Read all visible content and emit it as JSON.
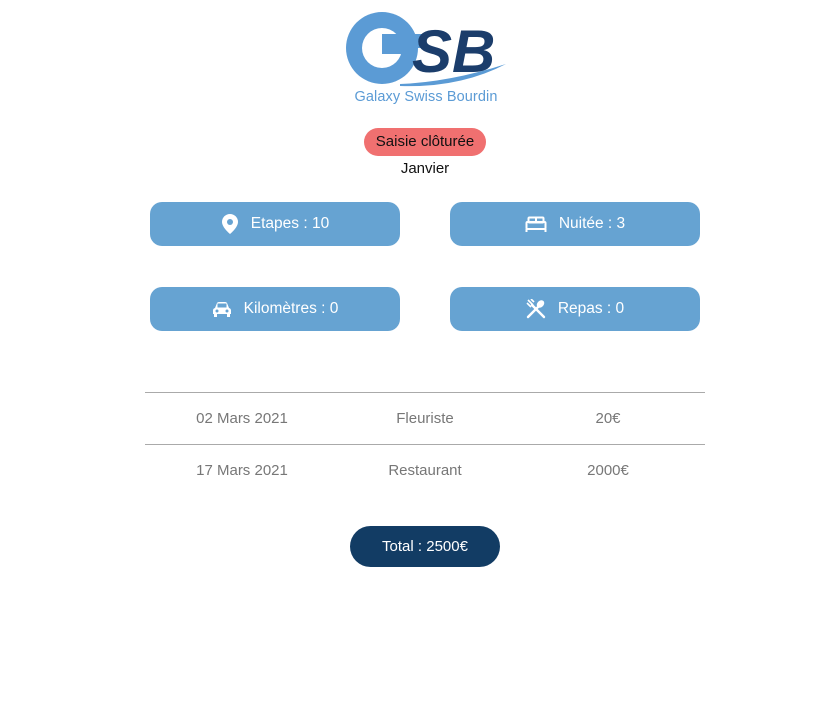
{
  "logo": {
    "tagline": "Galaxy Swiss Bourdin"
  },
  "status": {
    "label": "Saisie clôturée",
    "color": "#f07070"
  },
  "period": {
    "month": "Janvier"
  },
  "stats": {
    "etapes": {
      "label": "Etapes : 10",
      "icon": "map-pin-icon"
    },
    "nuitee": {
      "label": "Nuitée : 3",
      "icon": "bed-icon"
    },
    "kilometres": {
      "label": "Kilomètres : 0",
      "icon": "car-icon"
    },
    "repas": {
      "label": "Repas : 0",
      "icon": "utensils-icon"
    }
  },
  "expenses": {
    "rows": [
      {
        "date": "02 Mars 2021",
        "label": "Fleuriste",
        "amount": "20€"
      },
      {
        "date": "17 Mars 2021",
        "label": "Restaurant",
        "amount": "2000€"
      }
    ]
  },
  "total": {
    "label": "Total : 2500€"
  },
  "colors": {
    "accent": "#66a3d2",
    "primary": "#123c64",
    "badge": "#f07070"
  }
}
